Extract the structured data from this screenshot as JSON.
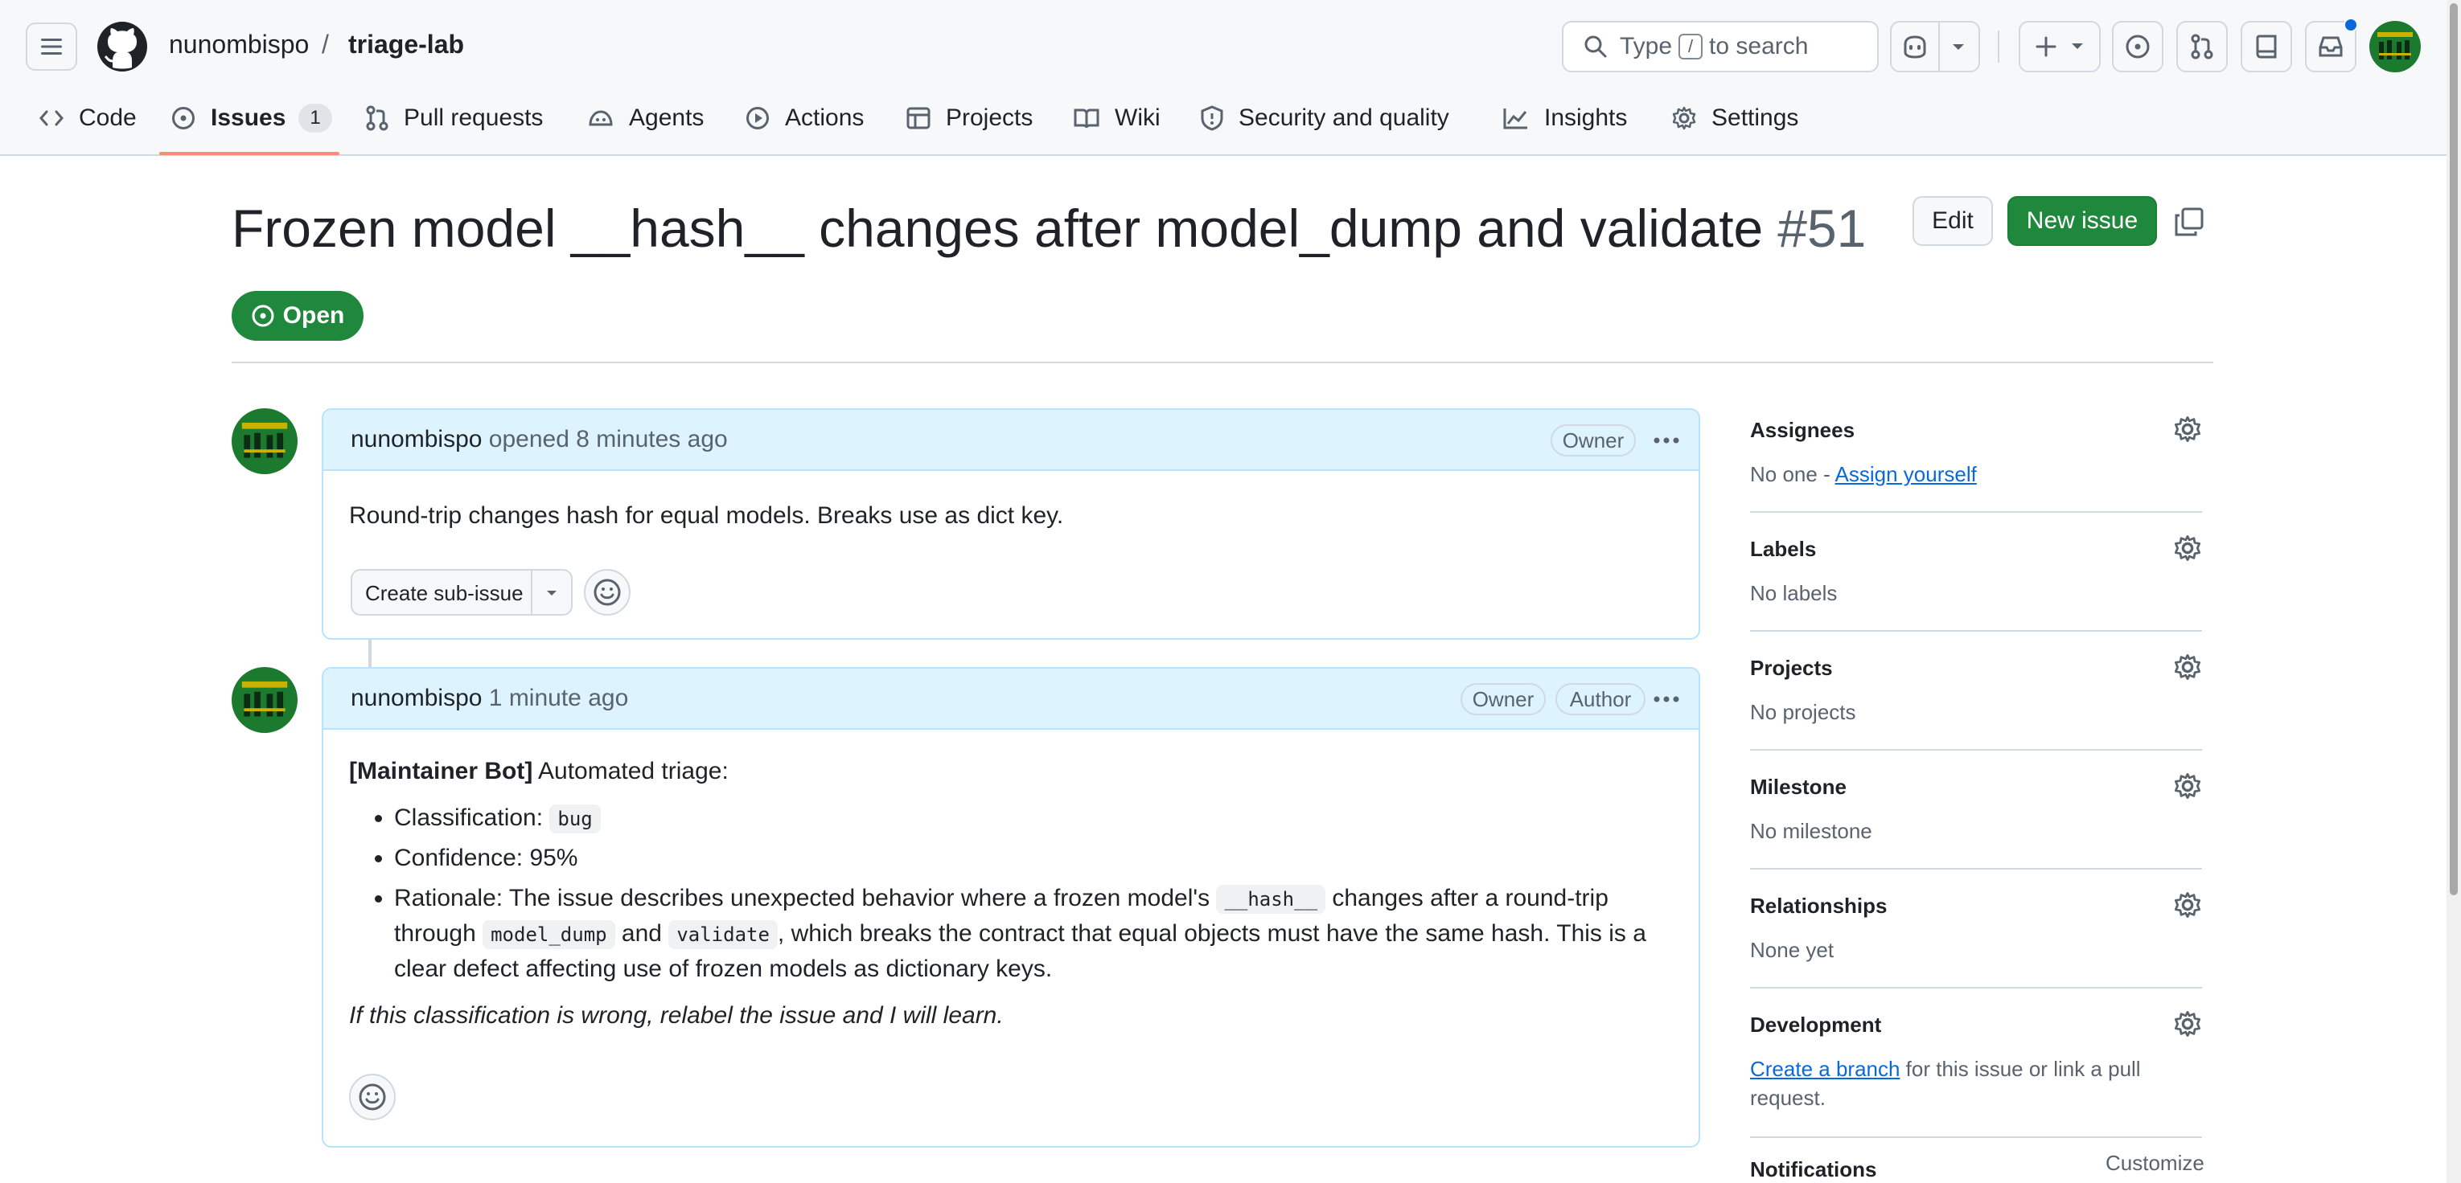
{
  "header": {
    "owner": "nunombispo",
    "separator": "/",
    "repo": "triage-lab",
    "search_prefix": "Type",
    "search_key": "/",
    "search_suffix": "to search"
  },
  "tabs": [
    {
      "label": "Code",
      "icon": "code-icon"
    },
    {
      "label": "Issues",
      "icon": "issue-opened-icon",
      "count": "1",
      "selected": true
    },
    {
      "label": "Pull requests",
      "icon": "git-pull-request-icon"
    },
    {
      "label": "Agents",
      "icon": "agent-icon"
    },
    {
      "label": "Actions",
      "icon": "play-icon"
    },
    {
      "label": "Projects",
      "icon": "table-icon"
    },
    {
      "label": "Wiki",
      "icon": "book-icon"
    },
    {
      "label": "Security and quality",
      "icon": "shield-icon"
    },
    {
      "label": "Insights",
      "icon": "graph-icon"
    },
    {
      "label": "Settings",
      "icon": "gear-icon"
    }
  ],
  "issue": {
    "title": "Frozen model __hash__ changes after model_dump and validate",
    "number": "#51",
    "state": "Open",
    "edit_label": "Edit",
    "new_issue_label": "New issue"
  },
  "comments": [
    {
      "author": "nunombispo",
      "meta": "opened 8 minutes ago",
      "badges": [
        "Owner"
      ],
      "body": "Round-trip changes hash for equal models. Breaks use as dict key.",
      "sub_issue_label": "Create sub-issue"
    },
    {
      "author": "nunombispo",
      "meta": "1 minute ago",
      "badges": [
        "Owner",
        "Author"
      ],
      "intro_bold": "[Maintainer Bot]",
      "intro_rest": " Automated triage:",
      "classification_label": "Classification: ",
      "classification_value": "bug",
      "confidence": "Confidence: 95%",
      "rationale_1": "Rationale: The issue describes unexpected behavior where a frozen model's ",
      "rationale_code_1": "__hash__",
      "rationale_2": " changes after a round-trip through ",
      "rationale_code_2": "model_dump",
      "rationale_3": " and ",
      "rationale_code_3": "validate",
      "rationale_4": ", which breaks the contract that equal objects must have the same hash. This is a clear defect affecting use of frozen models as dictionary keys.",
      "footer": "If this classification is wrong, relabel the issue and I will learn."
    }
  ],
  "sidebar": {
    "assignees": {
      "title": "Assignees",
      "value_prefix": "No one - ",
      "link": "Assign yourself"
    },
    "labels": {
      "title": "Labels",
      "value": "No labels"
    },
    "projects": {
      "title": "Projects",
      "value": "No projects"
    },
    "milestone": {
      "title": "Milestone",
      "value": "No milestone"
    },
    "relationships": {
      "title": "Relationships",
      "value": "None yet"
    },
    "development": {
      "title": "Development",
      "link": "Create a branch",
      "value_suffix": " for this issue or link a pull request."
    },
    "notifications": {
      "title": "Notifications",
      "customize": "Customize"
    }
  },
  "colors": {
    "accent_green": "#1f883d",
    "link_blue": "#0969da",
    "tab_underline": "#fd8c73",
    "comment_header": "#ddf4ff"
  }
}
